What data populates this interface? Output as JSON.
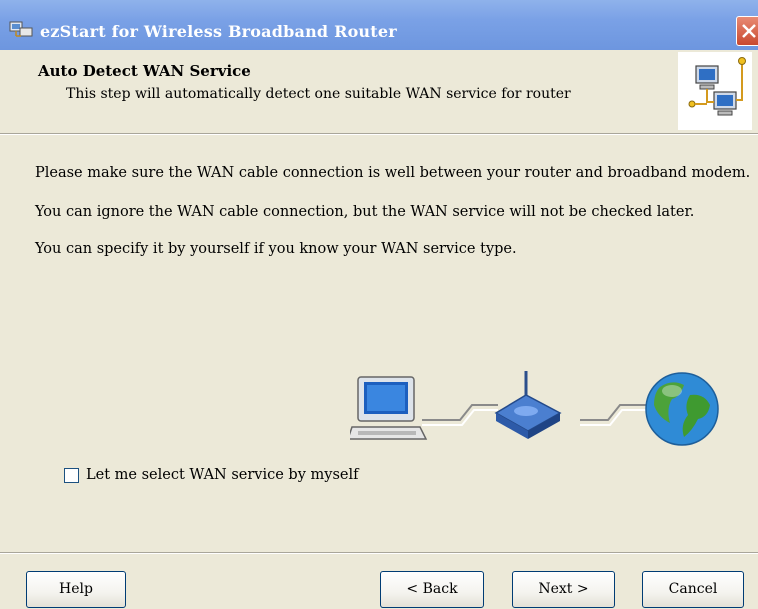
{
  "window": {
    "title": "ezStart for Wireless Broadband Router"
  },
  "header": {
    "title": "Auto Detect WAN Service",
    "subtitle": "This step will automatically detect one suitable WAN service for router"
  },
  "body": {
    "lines": [
      "Please make sure the WAN cable connection is well between your router and broadband modem.",
      "You can ignore the WAN cable connection, but the WAN service will not be checked later.",
      "You can specify it by yourself if you know your WAN service type."
    ]
  },
  "checkbox": {
    "label": "Let me select WAN service by myself",
    "checked": false
  },
  "buttons": {
    "help": "Help",
    "back": "< Back",
    "next": "Next >",
    "cancel": "Cancel"
  },
  "icons": {
    "title": "network-app-icon",
    "header": "network-computers-icon",
    "illustration": [
      "computer-icon",
      "router-icon",
      "globe-icon"
    ]
  }
}
